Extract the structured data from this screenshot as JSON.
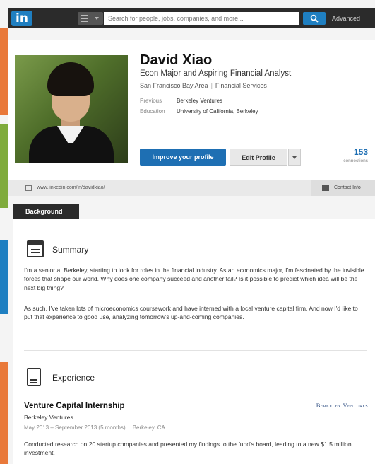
{
  "nav": {
    "logo": "in",
    "search_placeholder": "Search for people, jobs, companies, and more...",
    "advanced": "Advanced"
  },
  "profile": {
    "name": "David Xiao",
    "headline": "Econ Major and Aspiring Financial Analyst",
    "location": "San Francisco Bay Area",
    "industry": "Financial Services",
    "previous_label": "Previous",
    "previous_value": "Berkeley Ventures",
    "education_label": "Education",
    "education_value": "University of California, Berkeley",
    "improve_button": "Improve your profile",
    "edit_button": "Edit Profile",
    "connections_count": "153",
    "connections_label": "connections",
    "url": "www.linkedin.com/in/davidxiao/",
    "contact_info": "Contact Info"
  },
  "background": {
    "tab_label": "Background",
    "summary": {
      "title": "Summary",
      "paragraphs": [
        "I'm a senior at Berkeley, starting to look for roles in the financial industry. As an economics major, I'm fascinated by the invisible forces that shape our world. Why does one company succeed and another fail? Is it possible to predict which idea will be the next big thing?",
        "As such, I've taken lots of microeconomics coursework and have interned with a local venture capital firm. And now I'd like to put that experience to good use, analyzing tomorrow's up-and-coming companies."
      ]
    },
    "experience": {
      "title": "Experience",
      "jobs": [
        {
          "title": "Venture Capital Internship",
          "company": "Berkeley Ventures",
          "dates": "May 2013 – September 2013 (5 months)",
          "location": "Berkeley, CA",
          "company_logo": "Berkeley Ventures",
          "description": "Conducted research on 20 startup companies and presented my findings to the fund's board, leading to a new $1.5 million investment."
        }
      ]
    }
  },
  "colors": {
    "brand_blue": "#1f7fc1",
    "button_blue": "#1e6fb3",
    "side_orange": "#e9793a",
    "side_green": "#7fab3c"
  }
}
